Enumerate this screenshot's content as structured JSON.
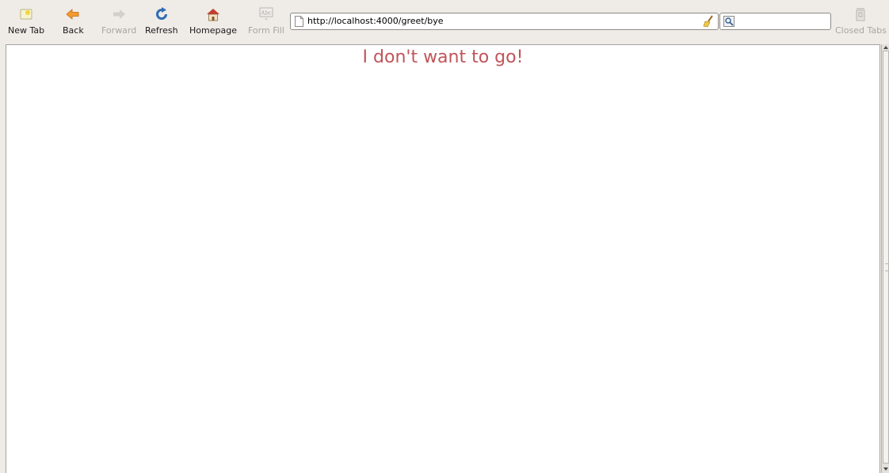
{
  "toolbar": {
    "new_tab": "New Tab",
    "back": "Back",
    "forward": "Forward",
    "refresh": "Refresh",
    "homepage": "Homepage",
    "form_fill": "Form Fill",
    "closed_tabs": "Closed Tabs"
  },
  "address_bar": {
    "url": "http://localhost:4000/greet/bye"
  },
  "search_box": {
    "value": ""
  },
  "page": {
    "heading": "I don't want to go!"
  },
  "colors": {
    "heading": "#c0545a",
    "chrome_background": "#efebe7"
  },
  "icons": {
    "new_tab": "new-tab-icon",
    "back": "back-arrow-icon",
    "forward": "forward-arrow-icon",
    "refresh": "refresh-icon",
    "homepage": "home-icon",
    "form_fill": "form-fill-icon",
    "closed_tabs": "trash-can-icon",
    "clear_url": "broom-icon",
    "search": "magnifier-icon",
    "page": "page-icon"
  }
}
